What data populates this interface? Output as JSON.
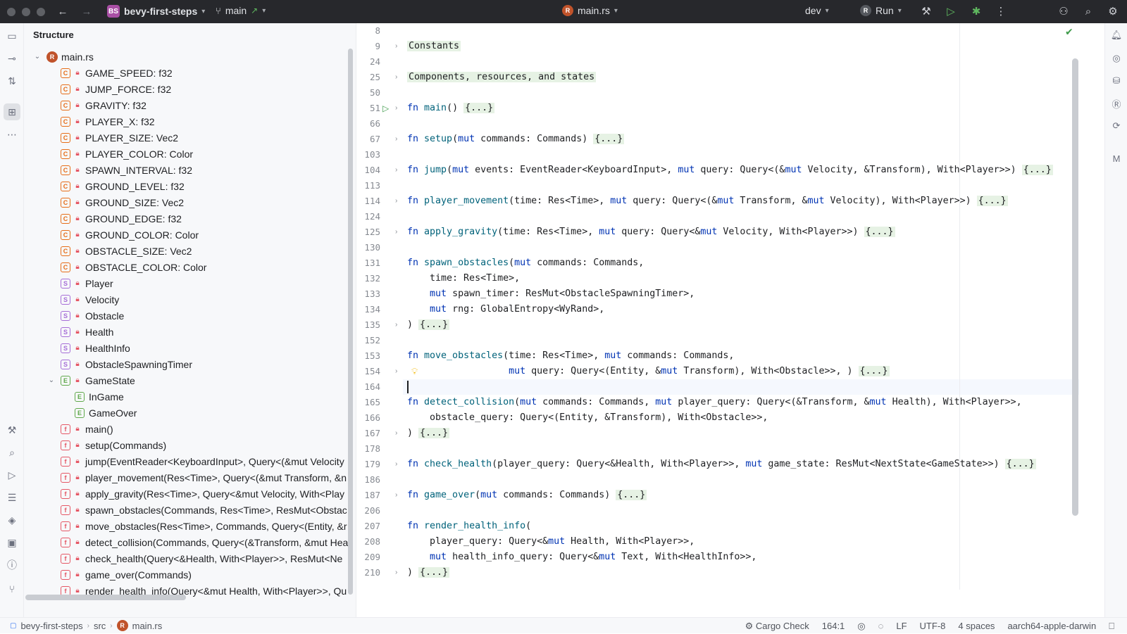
{
  "titlebar": {
    "project_badge": "BS",
    "project": "bevy-first-steps",
    "branch": "main",
    "file": "main.rs",
    "profile": "dev",
    "run_label": "Run"
  },
  "structure": {
    "title": "Structure",
    "root": "main.rs",
    "items": [
      {
        "kind": "C",
        "label": "GAME_SPEED: f32",
        "depth": 1
      },
      {
        "kind": "C",
        "label": "JUMP_FORCE: f32",
        "depth": 1
      },
      {
        "kind": "C",
        "label": "GRAVITY: f32",
        "depth": 1
      },
      {
        "kind": "C",
        "label": "PLAYER_X: f32",
        "depth": 1
      },
      {
        "kind": "C",
        "label": "PLAYER_SIZE: Vec2",
        "depth": 1
      },
      {
        "kind": "C",
        "label": "PLAYER_COLOR: Color",
        "depth": 1
      },
      {
        "kind": "C",
        "label": "SPAWN_INTERVAL: f32",
        "depth": 1
      },
      {
        "kind": "C",
        "label": "GROUND_LEVEL: f32",
        "depth": 1
      },
      {
        "kind": "C",
        "label": "GROUND_SIZE: Vec2",
        "depth": 1
      },
      {
        "kind": "C",
        "label": "GROUND_EDGE: f32",
        "depth": 1
      },
      {
        "kind": "C",
        "label": "GROUND_COLOR: Color",
        "depth": 1
      },
      {
        "kind": "C",
        "label": "OBSTACLE_SIZE: Vec2",
        "depth": 1
      },
      {
        "kind": "C",
        "label": "OBSTACLE_COLOR: Color",
        "depth": 1
      },
      {
        "kind": "S",
        "label": "Player",
        "depth": 1
      },
      {
        "kind": "S",
        "label": "Velocity",
        "depth": 1
      },
      {
        "kind": "S",
        "label": "Obstacle",
        "depth": 1
      },
      {
        "kind": "S",
        "label": "Health",
        "depth": 1
      },
      {
        "kind": "S",
        "label": "HealthInfo",
        "depth": 1
      },
      {
        "kind": "S",
        "label": "ObstacleSpawningTimer",
        "depth": 1
      },
      {
        "kind": "E",
        "label": "GameState",
        "depth": 1
      },
      {
        "kind": "E",
        "label": "InGame",
        "depth": 2
      },
      {
        "kind": "E",
        "label": "GameOver",
        "depth": 2
      },
      {
        "kind": "f",
        "label": "main()",
        "depth": 1
      },
      {
        "kind": "f",
        "label": "setup(Commands)",
        "depth": 1
      },
      {
        "kind": "f",
        "label": "jump(EventReader<KeyboardInput>, Query<(&mut Velocity",
        "depth": 1
      },
      {
        "kind": "f",
        "label": "player_movement(Res<Time>, Query<(&mut Transform, &n",
        "depth": 1
      },
      {
        "kind": "f",
        "label": "apply_gravity(Res<Time>, Query<&mut Velocity, With<Play",
        "depth": 1
      },
      {
        "kind": "f",
        "label": "spawn_obstacles(Commands, Res<Time>, ResMut<Obstac",
        "depth": 1
      },
      {
        "kind": "f",
        "label": "move_obstacles(Res<Time>, Commands, Query<(Entity, &r",
        "depth": 1
      },
      {
        "kind": "f",
        "label": "detect_collision(Commands, Query<(&Transform, &mut Hea",
        "depth": 1
      },
      {
        "kind": "f",
        "label": "check_health(Query<&Health, With<Player>>, ResMut<Ne",
        "depth": 1
      },
      {
        "kind": "f",
        "label": "game_over(Commands)",
        "depth": 1
      },
      {
        "kind": "f",
        "label": "render_health_info(Query<&mut Health, With<Player>>, Qu",
        "depth": 1
      }
    ]
  },
  "editor": {
    "lines": [
      {
        "n": "8",
        "t": ""
      },
      {
        "n": "9",
        "t": "Constants"
      },
      {
        "n": "24",
        "t": ""
      },
      {
        "n": "25",
        "t": "Components, resources, and states"
      },
      {
        "n": "50",
        "t": ""
      },
      {
        "n": "51",
        "t": "fn main() {...}"
      },
      {
        "n": "66",
        "t": ""
      },
      {
        "n": "67",
        "t": "fn setup(mut commands: Commands) {...}"
      },
      {
        "n": "103",
        "t": ""
      },
      {
        "n": "104",
        "t": "fn jump(mut events: EventReader<KeyboardInput>, mut query: Query<(&mut Velocity, &Transform), With<Player>>) {...}"
      },
      {
        "n": "113",
        "t": ""
      },
      {
        "n": "114",
        "t": "fn player_movement(time: Res<Time>, mut query: Query<(&mut Transform, &mut Velocity), With<Player>>) {...}"
      },
      {
        "n": "124",
        "t": ""
      },
      {
        "n": "125",
        "t": "fn apply_gravity(time: Res<Time>, mut query: Query<&mut Velocity, With<Player>>) {...}"
      },
      {
        "n": "130",
        "t": ""
      },
      {
        "n": "131",
        "t": "fn spawn_obstacles(mut commands: Commands,"
      },
      {
        "n": "132",
        "t": "    time: Res<Time>,"
      },
      {
        "n": "133",
        "t": "    mut spawn_timer: ResMut<ObstacleSpawningTimer>,"
      },
      {
        "n": "134",
        "t": "    mut rng: GlobalEntropy<WyRand>,"
      },
      {
        "n": "135",
        "t": ") {...}"
      },
      {
        "n": "152",
        "t": ""
      },
      {
        "n": "153",
        "t": "fn move_obstacles(time: Res<Time>, mut commands: Commands,"
      },
      {
        "n": "154",
        "t": "                  mut query: Query<(Entity, &mut Transform), With<Obstacle>>, ) {...}"
      },
      {
        "n": "164",
        "t": ""
      },
      {
        "n": "165",
        "t": "fn detect_collision(mut commands: Commands, mut player_query: Query<(&Transform, &mut Health), With<Player>>,"
      },
      {
        "n": "166",
        "t": "    obstacle_query: Query<(Entity, &Transform), With<Obstacle>>,"
      },
      {
        "n": "167",
        "t": ") {...}"
      },
      {
        "n": "178",
        "t": ""
      },
      {
        "n": "179",
        "t": "fn check_health(player_query: Query<&Health, With<Player>>, mut game_state: ResMut<NextState<GameState>>) {...}"
      },
      {
        "n": "186",
        "t": ""
      },
      {
        "n": "187",
        "t": "fn game_over(mut commands: Commands) {...}"
      },
      {
        "n": "206",
        "t": ""
      },
      {
        "n": "207",
        "t": "fn render_health_info("
      },
      {
        "n": "208",
        "t": "    player_query: Query<&mut Health, With<Player>>,"
      },
      {
        "n": "209",
        "t": "    mut health_info_query: Query<&mut Text, With<HealthInfo>>,"
      },
      {
        "n": "210",
        "t": ") {...}"
      }
    ]
  },
  "statusbar": {
    "crumb_project": "bevy-first-steps",
    "crumb_src": "src",
    "crumb_file": "main.rs",
    "cargo_check": "Cargo Check",
    "position": "164:1",
    "line_sep": "LF",
    "encoding": "UTF-8",
    "indent": "4 spaces",
    "target": "aarch64-apple-darwin"
  }
}
